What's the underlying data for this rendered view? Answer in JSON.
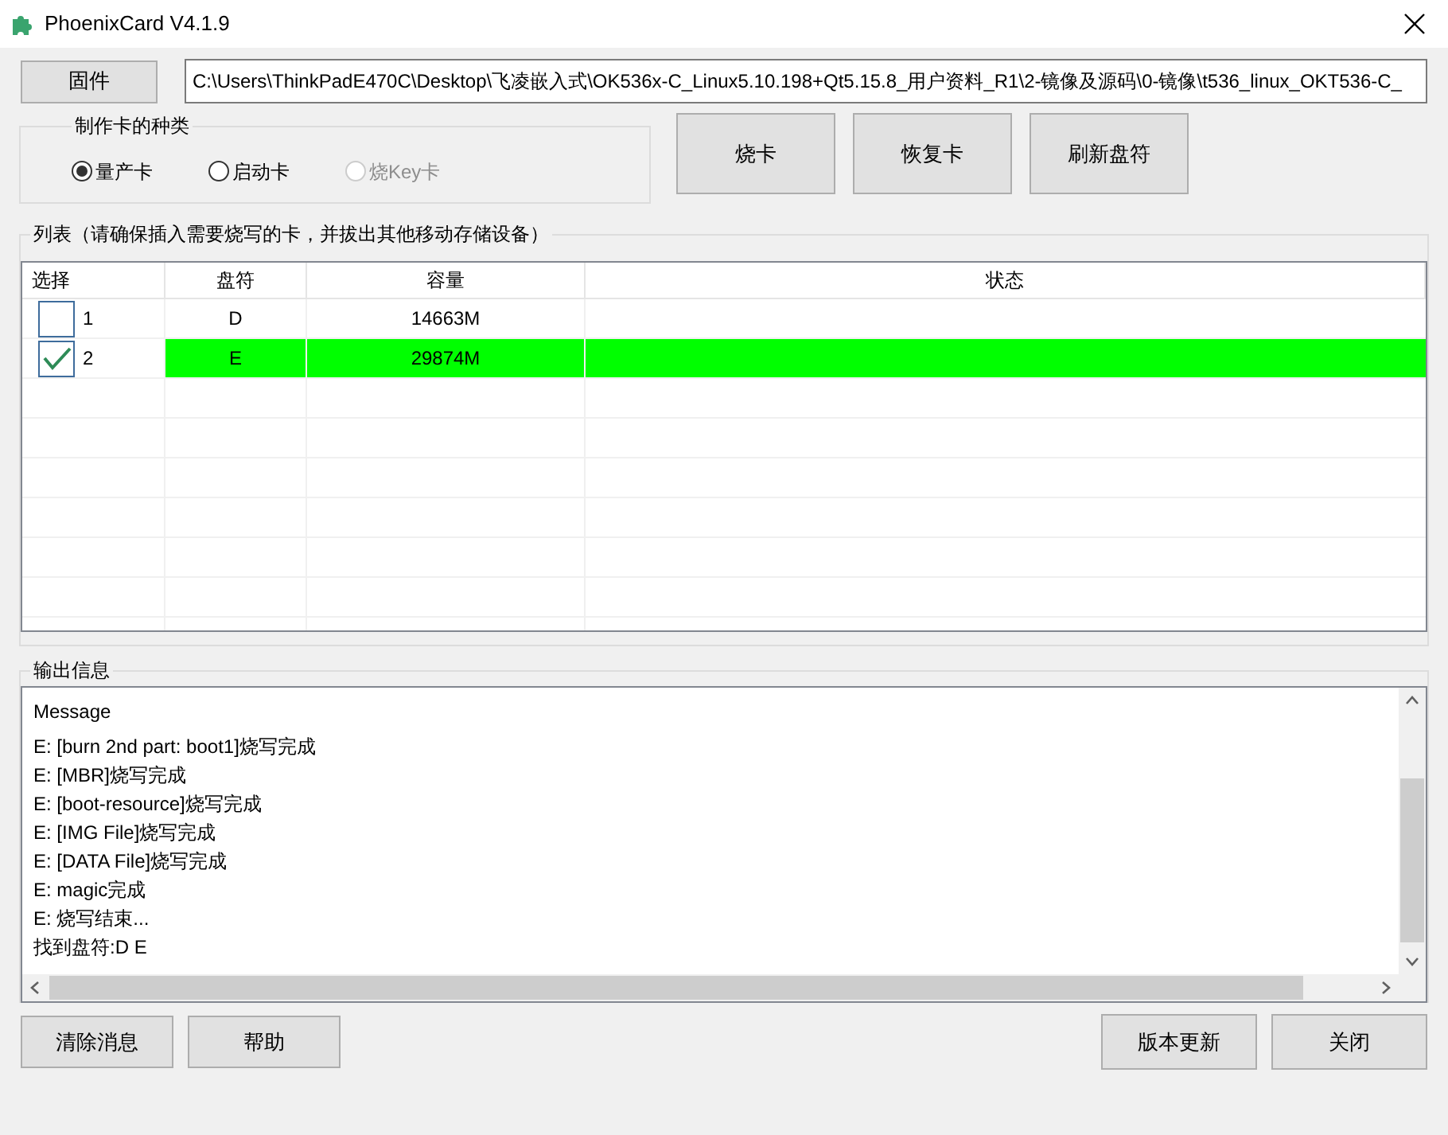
{
  "window": {
    "title": "PhoenixCard V4.1.9"
  },
  "firmware": {
    "button": "固件",
    "path": "C:\\Users\\ThinkPadE470C\\Desktop\\飞凌嵌入式\\OK536x-C_Linux5.10.198+Qt5.15.8_用户资料_R1\\2-镜像及源码\\0-镜像\\t536_linux_OKT536-C_"
  },
  "card_type": {
    "title": "制作卡的种类",
    "options": [
      {
        "label": "量产卡",
        "selected": true,
        "disabled": false
      },
      {
        "label": "启动卡",
        "selected": false,
        "disabled": false
      },
      {
        "label": "烧Key卡",
        "selected": false,
        "disabled": true
      }
    ]
  },
  "actions": [
    "烧卡",
    "恢复卡",
    "刷新盘符"
  ],
  "list": {
    "title": "列表（请确保插入需要烧写的卡，并拔出其他移动存储设备）",
    "columns": [
      "选择",
      "盘符",
      "容量",
      "状态"
    ],
    "rows": [
      {
        "index": "1",
        "drive": "D",
        "capacity": "14663M",
        "checked": false
      },
      {
        "index": "2",
        "drive": "E",
        "capacity": "29874M",
        "checked": true
      }
    ]
  },
  "output": {
    "title": "输出信息",
    "lines": [
      "Message",
      "E: [burn 2nd part: boot1]烧写完成",
      "E: [MBR]烧写完成",
      "E: [boot-resource]烧写完成",
      "E: [IMG File]烧写完成",
      "E: [DATA File]烧写完成",
      "E: magic完成",
      "E: 烧写结束...",
      "找到盘符:D E"
    ]
  },
  "footer_left": [
    "清除消息",
    "帮助"
  ],
  "footer_right": [
    "版本更新",
    "关闭"
  ]
}
